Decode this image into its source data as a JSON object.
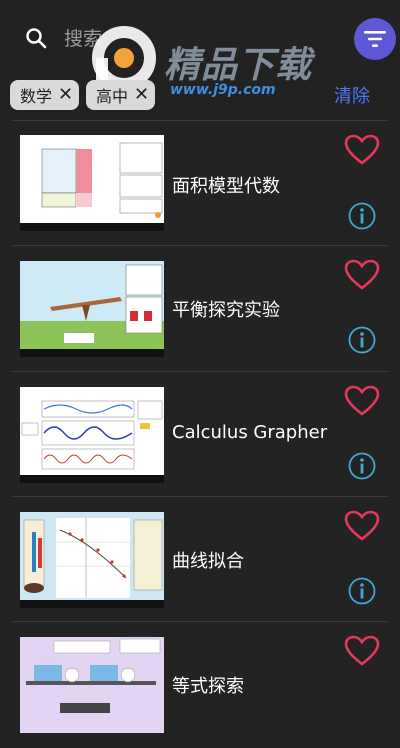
{
  "search": {
    "placeholder": "搜索"
  },
  "watermark": {
    "title": "精品下载",
    "url": "www.j9p.com"
  },
  "filters": {
    "chips": [
      {
        "label": "数学",
        "remove": "✕"
      },
      {
        "label": "高中",
        "remove": "✕"
      }
    ],
    "clear_label": "清除"
  },
  "sims": [
    {
      "title": "面积模型代数",
      "favorite_icon": "heart-outline-icon",
      "info_icon": "info-icon"
    },
    {
      "title": "平衡探究实验",
      "favorite_icon": "heart-outline-icon",
      "info_icon": "info-icon"
    },
    {
      "title": "Calculus Grapher",
      "favorite_icon": "heart-outline-icon",
      "info_icon": "info-icon"
    },
    {
      "title": "曲线拟合",
      "favorite_icon": "heart-outline-icon",
      "info_icon": "info-icon"
    },
    {
      "title": "等式探索",
      "favorite_icon": "heart-outline-icon",
      "info_icon": "info-icon"
    }
  ],
  "colors": {
    "accent": "#5f58d6",
    "clear": "#4d79ff",
    "heart": "#e8385a",
    "info": "#3fa9d8",
    "background": "#232323"
  }
}
